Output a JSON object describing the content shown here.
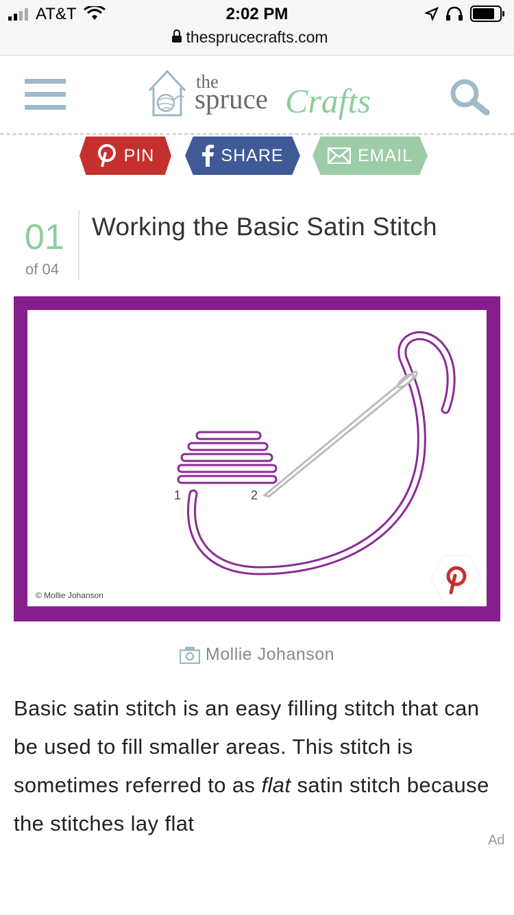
{
  "status_bar": {
    "carrier": "AT&T",
    "time": "2:02 PM"
  },
  "url_bar": {
    "domain": "thesprucecrafts.com"
  },
  "header": {
    "logo_the": "the",
    "logo_spruce": "spruce",
    "logo_crafts": "Crafts",
    "menu_icon": "hamburger-menu-icon",
    "search_icon": "search-icon"
  },
  "share": {
    "pin_label": "PIN",
    "share_label": "SHARE",
    "email_label": "EMAIL"
  },
  "step": {
    "number": "01",
    "of_label": "of 04",
    "title": "Working the Basic Satin Stitch"
  },
  "illustration": {
    "label_1": "1",
    "label_2": "2",
    "copyright": "© Mollie Johanson",
    "frame_color": "#861f8d",
    "thread_color": "#8b2a95"
  },
  "credit": {
    "name": "Mollie Johanson"
  },
  "article": {
    "text_before": "Basic satin stitch is an easy filling stitch that can be used to fill smaller areas. This stitch is sometimes referred to as ",
    "text_em": "flat",
    "text_after": " satin stitch because the stitches lay flat",
    "ad_label": "Ad"
  },
  "colors": {
    "accent_green": "#8fcb9e",
    "pinterest_red": "#c5302e",
    "facebook_blue": "#3f5a97",
    "email_green": "#9dcda7"
  }
}
